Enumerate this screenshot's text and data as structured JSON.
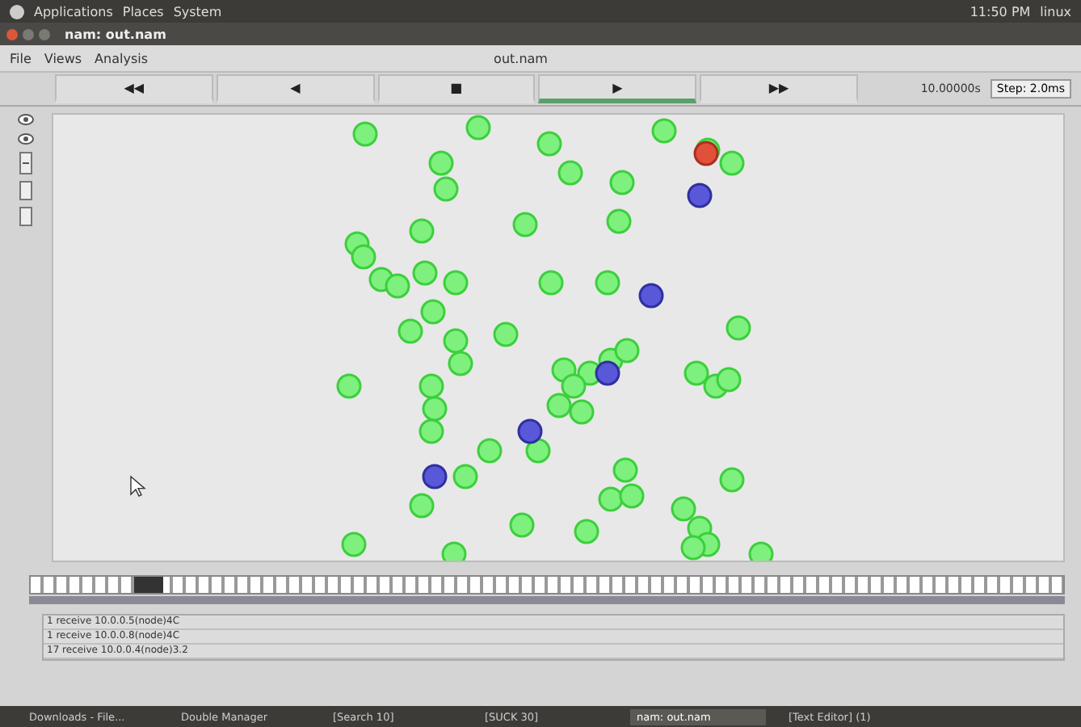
{
  "top_panel": {
    "menus": [
      "Applications",
      "Places",
      "System"
    ],
    "clock": "11:50 PM",
    "user": "linux"
  },
  "window": {
    "title": "nam: out.nam"
  },
  "menu_bar": {
    "items": [
      "File",
      "Views",
      "Analysis"
    ],
    "file_name": "out.nam"
  },
  "controls": {
    "buttons": [
      {
        "label": "◀◀",
        "selected": false
      },
      {
        "label": "◀",
        "selected": false
      },
      {
        "label": "■",
        "selected": false
      },
      {
        "label": "▶",
        "selected": true
      },
      {
        "label": "▶▶",
        "selected": false
      }
    ],
    "time": "10.00000s",
    "step": "Step: 2.0ms"
  },
  "timeline": {
    "level": 0.1
  },
  "log": [
    "1 receive 10.0.0.5(node)4C",
    "1 receive 10.0.0.8(node)4C",
    "17 receive 10.0.0.4(node)3.2"
  ],
  "taskbar": [
    {
      "label": "Downloads - File...",
      "selected": false
    },
    {
      "label": "Double Manager",
      "selected": false
    },
    {
      "label": "[Search 10]",
      "selected": false
    },
    {
      "label": "[SUCK 30]",
      "selected": false
    },
    {
      "label": "nam: out.nam",
      "selected": true
    },
    {
      "label": "[Text Editor] (1)",
      "selected": false
    }
  ]
}
